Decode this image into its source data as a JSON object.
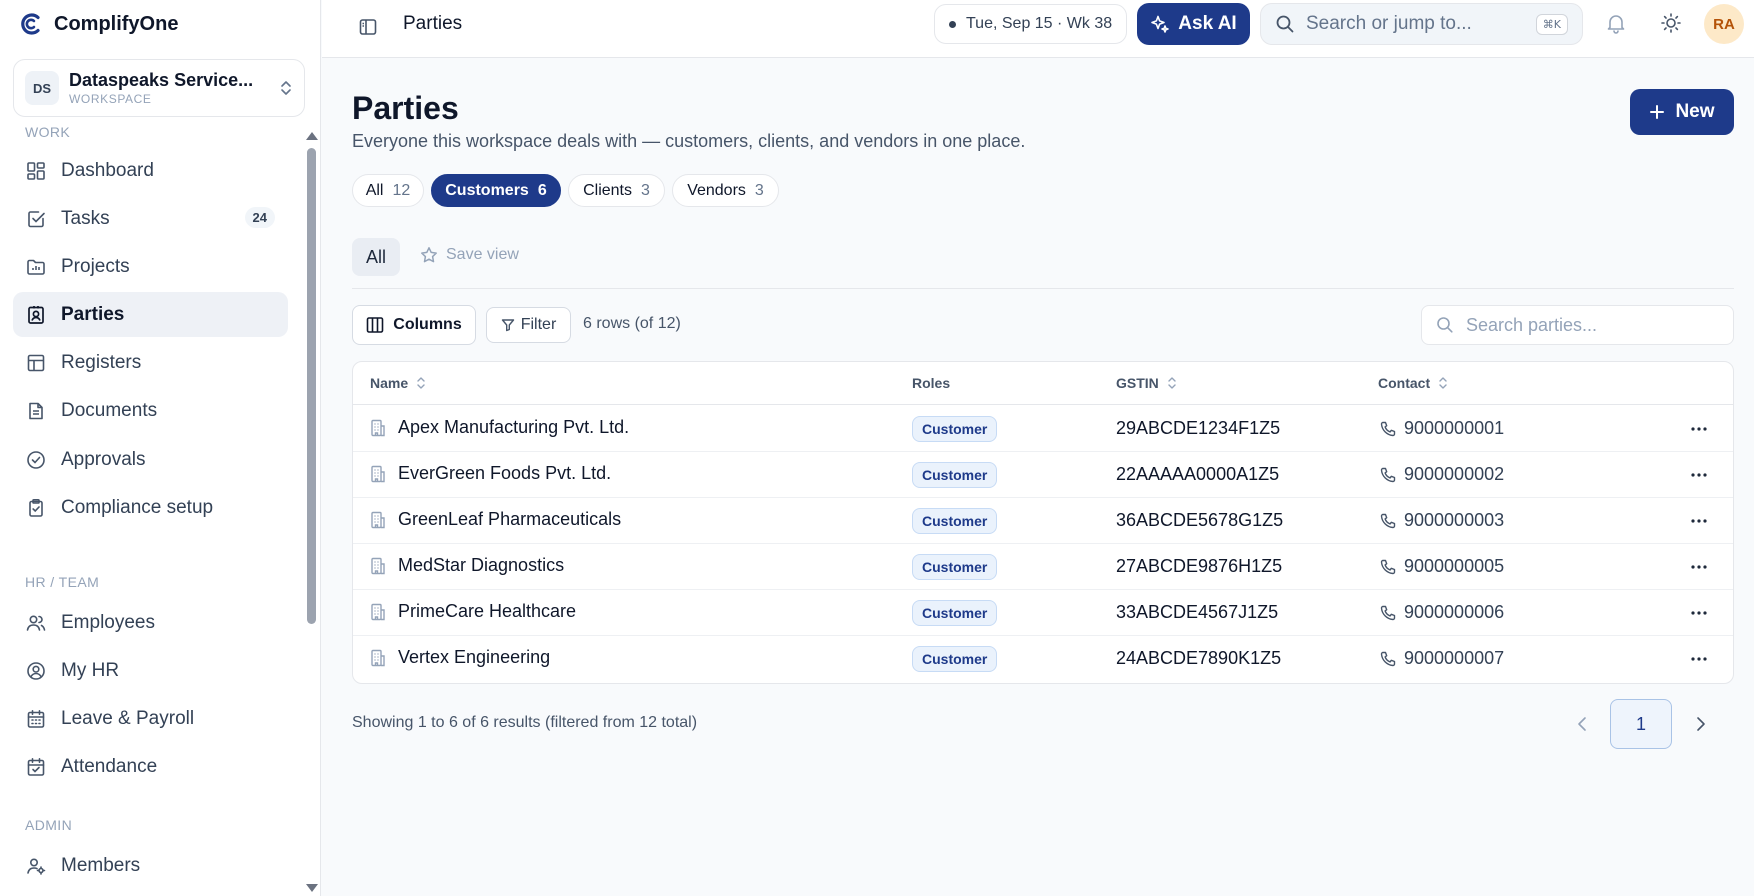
{
  "app": {
    "brand": "ComplifyOne",
    "workspace": {
      "initials": "DS",
      "name": "Dataspeaks Service...",
      "label": "WORKSPACE"
    }
  },
  "topbar": {
    "title": "Parties",
    "date": "Tue, Sep 15 · Wk 38",
    "ask_ai": "Ask AI",
    "search_placeholder": "Search or jump to...",
    "shortcut": "⌘K",
    "avatar_initials": "RA"
  },
  "sidebar": {
    "sections": [
      {
        "label": "WORK"
      },
      {
        "label": "HR / TEAM"
      },
      {
        "label": "ADMIN"
      }
    ],
    "items": [
      {
        "label": "Dashboard",
        "icon": "dashboard-icon"
      },
      {
        "label": "Tasks",
        "icon": "tasks-icon",
        "badge": "24"
      },
      {
        "label": "Projects",
        "icon": "projects-icon"
      },
      {
        "label": "Parties",
        "icon": "parties-icon",
        "active": true
      },
      {
        "label": "Registers",
        "icon": "registers-icon"
      },
      {
        "label": "Documents",
        "icon": "documents-icon"
      },
      {
        "label": "Approvals",
        "icon": "approvals-icon"
      },
      {
        "label": "Compliance setup",
        "icon": "compliance-icon"
      },
      {
        "label": "Employees",
        "icon": "employees-icon"
      },
      {
        "label": "My HR",
        "icon": "my-hr-icon"
      },
      {
        "label": "Leave & Payroll",
        "icon": "calendar-icon"
      },
      {
        "label": "Attendance",
        "icon": "attendance-icon"
      },
      {
        "label": "Members",
        "icon": "members-icon"
      }
    ]
  },
  "page": {
    "title": "Parties",
    "subtitle": "Everyone this workspace deals with — customers, clients, and vendors in one place.",
    "new_label": "New"
  },
  "tabs": [
    {
      "label": "All",
      "count": "12"
    },
    {
      "label": "Customers",
      "count": "6",
      "active": true
    },
    {
      "label": "Clients",
      "count": "3"
    },
    {
      "label": "Vendors",
      "count": "3"
    }
  ],
  "views": {
    "all_label": "All",
    "save_label": "Save view"
  },
  "toolbar": {
    "columns_label": "Columns",
    "filter_label": "Filter",
    "rows_count": "6 rows (of 12)",
    "search_placeholder": "Search parties..."
  },
  "table": {
    "headers": {
      "name": "Name",
      "roles": "Roles",
      "gstin": "GSTIN",
      "contact": "Contact"
    },
    "rows": [
      {
        "name": "Apex Manufacturing Pvt. Ltd.",
        "role": "Customer",
        "gstin": "29ABCDE1234F1Z5",
        "contact": "9000000001"
      },
      {
        "name": "EverGreen Foods Pvt. Ltd.",
        "role": "Customer",
        "gstin": "22AAAAA0000A1Z5",
        "contact": "9000000002"
      },
      {
        "name": "GreenLeaf Pharmaceuticals",
        "role": "Customer",
        "gstin": "36ABCDE5678G1Z5",
        "contact": "9000000003"
      },
      {
        "name": "MedStar Diagnostics",
        "role": "Customer",
        "gstin": "27ABCDE9876H1Z5",
        "contact": "9000000005"
      },
      {
        "name": "PrimeCare Healthcare",
        "role": "Customer",
        "gstin": "33ABCDE4567J1Z5",
        "contact": "9000000006"
      },
      {
        "name": "Vertex Engineering",
        "role": "Customer",
        "gstin": "24ABCDE7890K1Z5",
        "contact": "9000000007"
      }
    ]
  },
  "footer": {
    "showing": "Showing 1 to 6 of 6 results (filtered from 12 total)",
    "page": "1"
  },
  "colors": {
    "primary": "#1e3a8a",
    "badge_bg": "#eaf2fc",
    "active_nav_bg": "#eef1f6"
  }
}
